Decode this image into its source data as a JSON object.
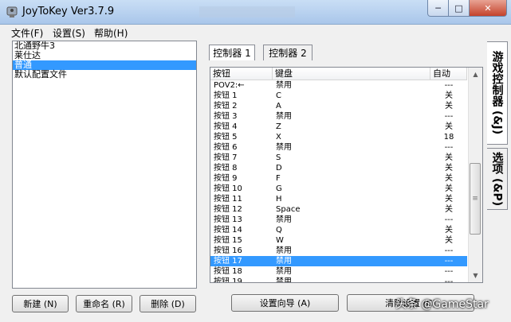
{
  "window": {
    "title": "JoyToKey Ver3.7.9",
    "min": "─",
    "max": "□",
    "close": "✕"
  },
  "menu": [
    "文件(F)",
    "设置(S)",
    "帮助(H)"
  ],
  "configs": [
    {
      "label": "北通野牛3",
      "selected": false
    },
    {
      "label": "莱仕达",
      "selected": false
    },
    {
      "label": "普通",
      "selected": true
    },
    {
      "label": "默认配置文件",
      "selected": false
    }
  ],
  "left_buttons": {
    "new": "新建 (N)",
    "rename": "重命名 (R)",
    "delete": "删除 (D)"
  },
  "tabs": {
    "controller1": "控制器 1",
    "controller2": "控制器 2"
  },
  "grid": {
    "headers": [
      "按钮",
      "键盘",
      "自动"
    ],
    "rows": [
      {
        "button": "POV2:←",
        "key": "禁用",
        "auto": "---"
      },
      {
        "button": "按钮 1",
        "key": "C",
        "auto": "关"
      },
      {
        "button": "按钮 2",
        "key": "A",
        "auto": "关"
      },
      {
        "button": "按钮 3",
        "key": "禁用",
        "auto": "---"
      },
      {
        "button": "按钮 4",
        "key": "Z",
        "auto": "关"
      },
      {
        "button": "按钮 5",
        "key": "X",
        "auto": "18"
      },
      {
        "button": "按钮 6",
        "key": "禁用",
        "auto": "---"
      },
      {
        "button": "按钮 7",
        "key": "S",
        "auto": "关"
      },
      {
        "button": "按钮 8",
        "key": "D",
        "auto": "关"
      },
      {
        "button": "按钮 9",
        "key": "F",
        "auto": "关"
      },
      {
        "button": "按钮 10",
        "key": "G",
        "auto": "关"
      },
      {
        "button": "按钮 11",
        "key": "H",
        "auto": "关"
      },
      {
        "button": "按钮 12",
        "key": "Space",
        "auto": "关"
      },
      {
        "button": "按钮 13",
        "key": "禁用",
        "auto": "---"
      },
      {
        "button": "按钮 14",
        "key": "Q",
        "auto": "关"
      },
      {
        "button": "按钮 15",
        "key": "W",
        "auto": "关"
      },
      {
        "button": "按钮 16",
        "key": "禁用",
        "auto": "---"
      },
      {
        "button": "按钮 17",
        "key": "禁用",
        "auto": "---",
        "selected": true
      },
      {
        "button": "按钮 18",
        "key": "禁用",
        "auto": "---"
      },
      {
        "button": "按钮 19",
        "key": "禁用",
        "auto": "---"
      }
    ]
  },
  "right_buttons": {
    "wizard": "设置向导 (A)",
    "clear": "清除设置 (C)"
  },
  "side_tabs": {
    "game": "游戏控制器 (&J)",
    "options": "选项 (&P)"
  },
  "watermark": "头条 @GameStar",
  "colors": {
    "selection": "#3399ff",
    "titlebar": "#b9d1ee",
    "close": "#c94a33"
  }
}
